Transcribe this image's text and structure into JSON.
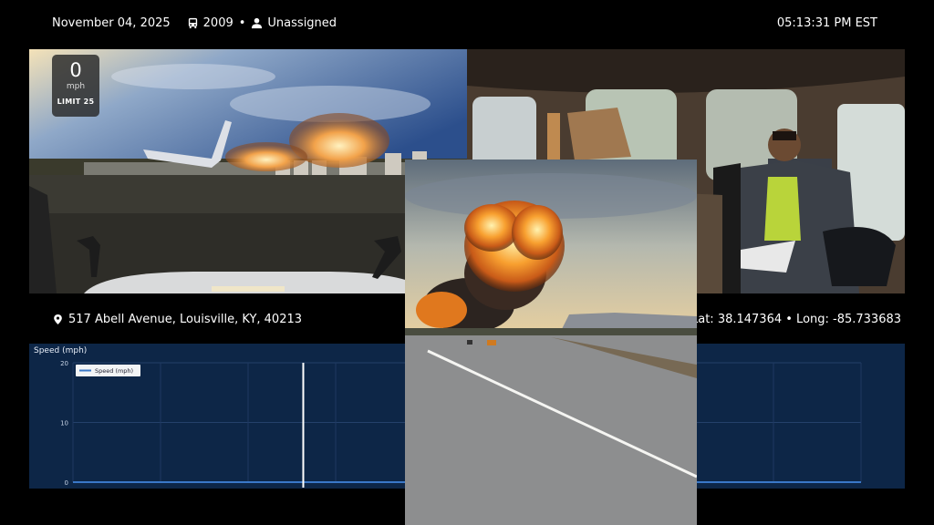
{
  "header": {
    "date": "November 04, 2025",
    "vehicle_id": "2009",
    "separator": "•",
    "driver": "Unassigned",
    "time": "05:13:31 PM EST",
    "icons": {
      "vehicle": "bus-icon",
      "driver": "person-icon"
    }
  },
  "speed_overlay": {
    "value": "0",
    "unit": "mph",
    "limit": "LIMIT 25"
  },
  "location": {
    "address": "517 Abell Avenue, Louisville, KY, 40213",
    "coordinates": "Lat: 38.147364 • Long: -85.733683",
    "icon": "map-pin-icon"
  },
  "chart": {
    "title": "Speed (mph)",
    "chart_data": {
      "type": "line",
      "title": "Speed (mph)",
      "yticks": [
        "20",
        "10",
        "0"
      ],
      "ylim": [
        0,
        20
      ],
      "grid": true,
      "legend": {
        "position": "top-left",
        "entries": [
          "Speed (mph)"
        ]
      },
      "series": [
        {
          "name": "Speed (mph)",
          "values": [
            0,
            0
          ]
        }
      ],
      "cursor_fraction": 0.57
    }
  },
  "colors": {
    "background": "#000000",
    "chart_panel": "#0d2647",
    "series_line": "#3a78c8",
    "cursor": "#ffffff"
  }
}
